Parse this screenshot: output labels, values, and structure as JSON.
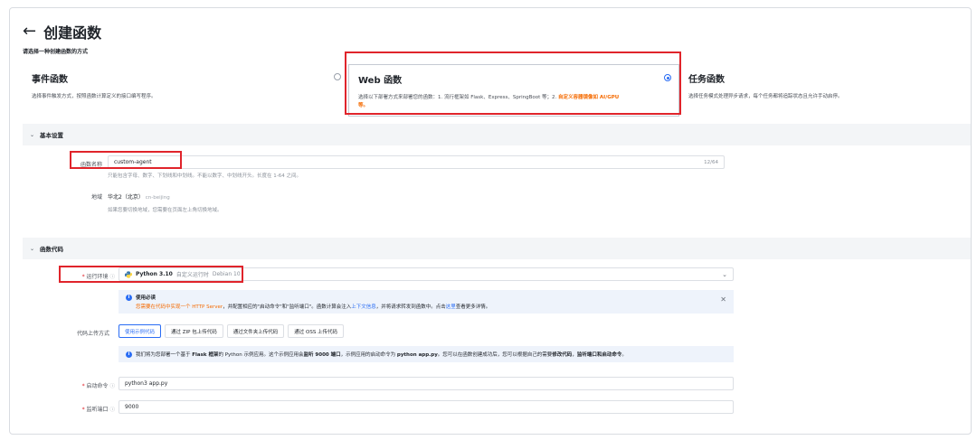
{
  "header": {
    "back_glyph": "←",
    "title": "创建函数"
  },
  "subtitle": "请选择一种创建函数的方式",
  "cards": [
    {
      "title": "事件函数",
      "desc": "选择事件触发方式，按照函数计算定义的接口编写程序。",
      "selected": false
    },
    {
      "title": "Web 函数",
      "desc_prefix": "选择以下部署方式来部署您的函数：1. 流行框架如 Flask、Express、SpringBoot 等；2. ",
      "desc_highlight": "自定义容器镜像如 AI/GPU",
      "desc_suffix": "等。",
      "selected": true
    },
    {
      "title": "任务函数",
      "desc": "选择任务模式处理异步请求，每个任务都将追踪状态且允许手动启停。",
      "selected": false
    }
  ],
  "basic": {
    "section_title": "基本设置",
    "name_label": "函数名称",
    "name_value": "custom-agent",
    "name_counter": "12/64",
    "name_hint": "只能包含字母、数字、下划线和中划线。不能以数字、中划线开头。长度在 1-64 之间。",
    "region_label": "地域",
    "region_value": "华北2（北京）",
    "region_code": "cn-beijing",
    "region_hint": "如果您要切换地域，您需要在页面左上角切换地域。"
  },
  "code": {
    "section_title": "函数代码",
    "runtime_label": "运行环境",
    "runtime_name": "Python 3.10",
    "runtime_type": "自定义运行时",
    "runtime_os": "Debian 10",
    "notice_title": "使用必读",
    "notice_orange": "您需要在代码中实现一个 HTTP Server",
    "notice_mid": "，并配置相应的\"启动命令\"和\"监听端口\"。函数计算会注入",
    "notice_link1": "上下文信息",
    "notice_mid2": "，并将请求转发到函数中。点击",
    "notice_link2": "这里",
    "notice_end": "查看更多详情。",
    "upload_label": "代码上传方式",
    "upload_tabs": [
      "使用示例代码",
      "通过 ZIP 包上传代码",
      "通过文件夹上传代码",
      "通过 OSS 上传代码"
    ],
    "info_pre": "我们将为您部署一个基于 ",
    "info_b1": "Flask 框架",
    "info_mid1": "的 Python 示例应用。这个示例应用会",
    "info_b2": "监听 9000 端口",
    "info_mid2": "，示例应用的启动命令为 ",
    "info_b3": "python app.py",
    "info_mid3": "。您可以在函数创建成功后，您可以根据自己的需要",
    "info_b4": "修改代码",
    "info_mid4": "，",
    "info_b5": "监听端口和启动命令",
    "info_end": "。",
    "start_label": "启动命令",
    "start_value": "python3 app.py",
    "port_label": "监听端口",
    "port_value": "9000"
  },
  "colors": {
    "accent": "#2a6df4",
    "highlight": "#f56a00",
    "annotation": "#e0242b"
  }
}
